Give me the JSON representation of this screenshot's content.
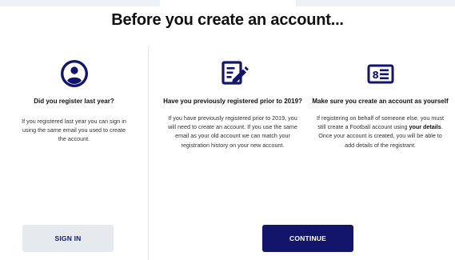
{
  "page": {
    "title": "Before you create an account...",
    "colors": {
      "navy": "#13156b",
      "muted_button": "#e6e9ee"
    }
  },
  "columns": [
    {
      "icon": "user-circle-icon",
      "heading": "Did you register last year?",
      "body": "If you registered last year you can sign in using the same email you used to create the account."
    },
    {
      "icon": "edit-document-icon",
      "heading": "Have you previously registered prior to 2019?",
      "body": "If you have previously registered prior to 2019, you will need to create an account. If you use the same email as your old account we can match your registration history on your new account."
    },
    {
      "icon": "id-card-icon",
      "heading": "Make sure you create an account as yourself",
      "body_before": "If registering on behalf of someone else, you must still create a Football account using ",
      "body_bold": "your details",
      "body_after": ". Once your account is created, you will be able to add details of the registrant."
    }
  ],
  "buttons": {
    "sign_in": "SIGN IN",
    "continue": "CONTINUE"
  }
}
